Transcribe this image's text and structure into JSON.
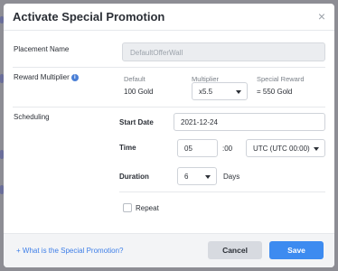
{
  "modal": {
    "title": "Activate Special Promotion",
    "close_symbol": "×"
  },
  "placement": {
    "label": "Placement Name",
    "value": "DefaultOfferWall"
  },
  "reward": {
    "label": "Reward Multiplier",
    "info_icon": "i",
    "default_header": "Default",
    "default_value": "100 Gold",
    "multiplier_header": "Multiplier",
    "multiplier_value": "x5.5",
    "special_header": "Special Reward",
    "special_value": "= 550 Gold"
  },
  "scheduling": {
    "label": "Scheduling",
    "start_date_label": "Start Date",
    "start_date_value": "2021-12-24",
    "time_label": "Time",
    "time_hour": "05",
    "time_minutes": ":00",
    "timezone_value": "UTC (UTC 00:00)",
    "duration_label": "Duration",
    "duration_value": "6",
    "duration_unit": "Days",
    "repeat_label": "Repeat",
    "repeat_checked": false
  },
  "footer": {
    "help_link": "+ What is the Special Promotion?",
    "cancel_label": "Cancel",
    "save_label": "Save"
  },
  "colors": {
    "primary": "#3d8bf0",
    "link": "#3d7ee8"
  }
}
